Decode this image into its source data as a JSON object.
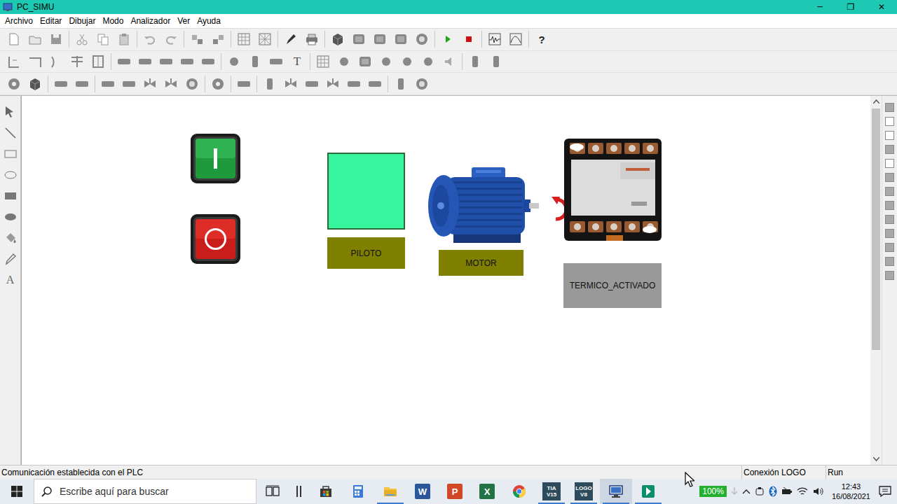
{
  "window": {
    "title": "PC_SIMU",
    "controls": [
      "─",
      "❐",
      "✕"
    ]
  },
  "menu": [
    "Archivo",
    "Editar",
    "Dibujar",
    "Modo",
    "Analizador",
    "Ver",
    "Ayuda"
  ],
  "toolbar": {
    "help": "?",
    "text_tool": "T"
  },
  "tools": {
    "text_tool": "A"
  },
  "canvas": {
    "pilot": {
      "label": "PILOTO",
      "on": true
    },
    "motor": {
      "label": "MOTOR",
      "running": true
    },
    "thermal": {
      "label": "TERMICO_ACTIVADO",
      "activated": false
    }
  },
  "scrollbar": {
    "level": 0.7
  },
  "status_bar": {
    "message": "Comunicación establecida con el PLC",
    "connection": "Conexión LOGO",
    "mode": "Run"
  },
  "taskbar": {
    "search": {
      "placeholder": "Escribe aquí para buscar"
    },
    "apps": [
      {
        "kind": "taskview",
        "open": false,
        "selected": false
      },
      {
        "kind": "bar",
        "open": false,
        "selected": false
      },
      {
        "kind": "store",
        "open": false,
        "selected": false
      },
      {
        "kind": "calc",
        "open": false,
        "selected": false
      },
      {
        "kind": "folder",
        "open": true,
        "selected": false
      },
      {
        "kind": "office",
        "glyph": "W",
        "color": "#2b579a",
        "open": false,
        "selected": false
      },
      {
        "kind": "office",
        "glyph": "P",
        "color": "#d24726",
        "open": false,
        "selected": false
      },
      {
        "kind": "office",
        "glyph": "X",
        "color": "#217346",
        "open": false,
        "selected": false
      },
      {
        "kind": "chrome",
        "open": false,
        "selected": false
      },
      {
        "kind": "twoline",
        "lines": [
          "TIA",
          "V15"
        ],
        "open": true,
        "selected": false
      },
      {
        "kind": "twoline",
        "lines": [
          "LOGO",
          "V8"
        ],
        "open": true,
        "selected": false
      },
      {
        "kind": "pcsimu",
        "open": true,
        "selected": true
      },
      {
        "kind": "green",
        "open": true,
        "selected": false
      }
    ],
    "battery": "100%",
    "time": "12:43",
    "date": "16/08/2021"
  }
}
